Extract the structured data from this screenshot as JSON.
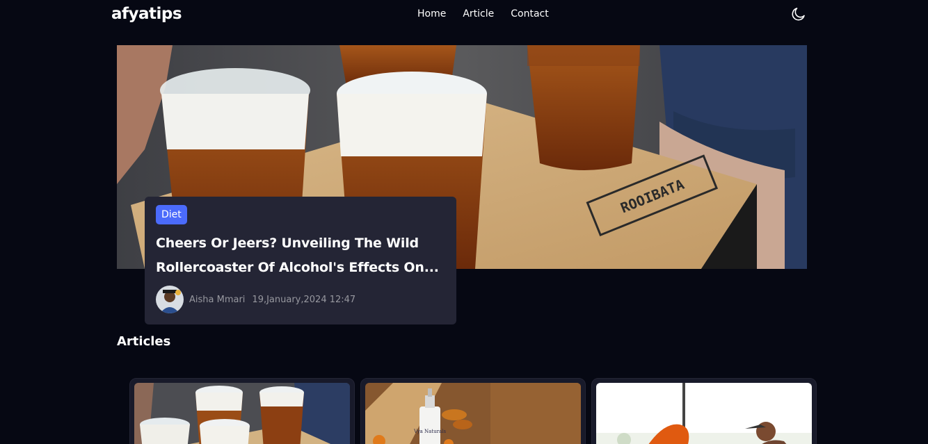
{
  "nav": {
    "logo": "afyatips",
    "links": [
      "Home",
      "Article",
      "Contact"
    ],
    "theme_icon": "moon-icon"
  },
  "hero": {
    "category": "Diet",
    "title_line1": "Cheers Or Jeers? Unveiling The Wild",
    "title_line2": "Rollercoaster Of Alcohol's Effects On...",
    "author": "Aisha Mmari",
    "date": "19,January,2024 12:47",
    "box_label": "ROOIBATA"
  },
  "articles": {
    "heading": "Articles",
    "cards": [
      {
        "image": "beer-cups-image"
      },
      {
        "image": "turmeric-lotion-image",
        "bottle_label": "Vya Naturals"
      },
      {
        "image": "fitness-woman-image"
      }
    ]
  },
  "colors": {
    "background": "#060813",
    "card": "#242535",
    "accent": "#4b6bfb",
    "muted_text": "#97989f"
  }
}
